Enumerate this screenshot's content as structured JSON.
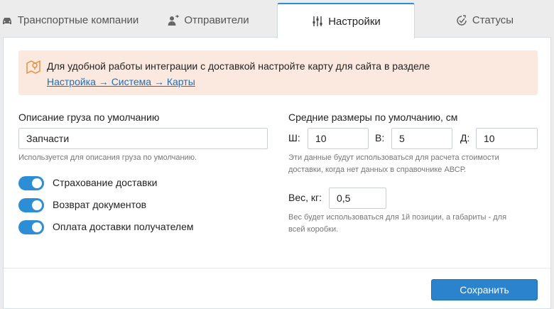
{
  "tabs": [
    {
      "label": "Транспортные компании",
      "icon": "car-icon"
    },
    {
      "label": "Отправители",
      "icon": "user-swap-icon"
    },
    {
      "label": "Настройки",
      "icon": "sliders-icon"
    },
    {
      "label": "Статусы",
      "icon": "clock-check-icon"
    }
  ],
  "active_tab": "Настройки",
  "alert": {
    "icon": "map-pin-icon",
    "text": "Для удобной работы интеграции с доставкой настройте карту для сайта в разделе",
    "link": "Настройка → Система → Карты"
  },
  "cargo": {
    "label": "Описание груза по умолчанию",
    "value": "Запчасти",
    "hint": "Используется для описания груза по умолчанию."
  },
  "toggles": [
    {
      "label": "Страхование доставки",
      "on": true
    },
    {
      "label": "Возврат документов",
      "on": true
    },
    {
      "label": "Оплата доставки получателем",
      "on": true
    }
  ],
  "sizes": {
    "label": "Средние размеры по умолчанию, см",
    "w_label": "Ш:",
    "w_value": "10",
    "h_label": "В:",
    "h_value": "5",
    "d_label": "Д:",
    "d_value": "10",
    "hint_line1": "Эти данные будут использоваться для расчета стоимости",
    "hint_line2": "доставки, когда нет данных в справочнике АВСР."
  },
  "weight": {
    "label": "Вес, кг:",
    "value": "0,5",
    "hint_line1": "Вес будет использоваться для 1й позиции, а габариты - для",
    "hint_line2": "всей коробки."
  },
  "save_label": "Сохранить",
  "colors": {
    "accent": "#2d8ed6",
    "alert_bg": "#fbe9df",
    "alert_icon": "#e8903f"
  }
}
